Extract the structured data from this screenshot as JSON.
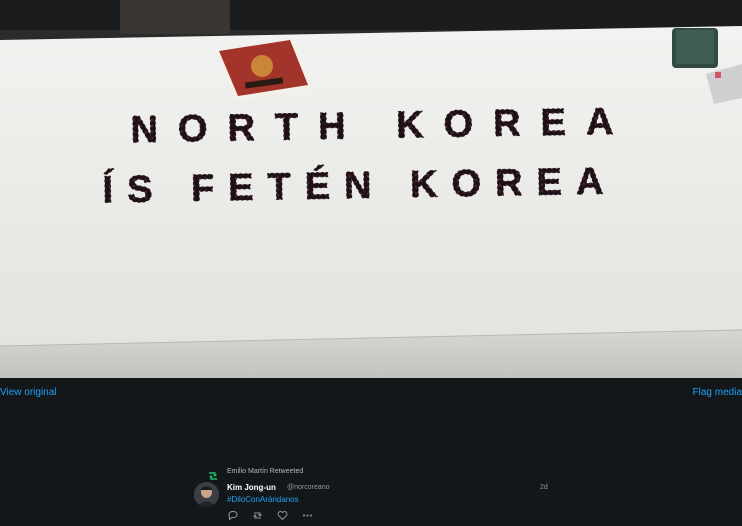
{
  "media": {
    "view_original_label": "View original",
    "flag_media_label": "Flag media",
    "photo": {
      "line1": "NORTH KOREA",
      "line2": "ÍS FETÉN KOREA",
      "colors": {
        "table": "#e9e9e6",
        "table_edge": "#c9c9c6",
        "berries": "#2a1820"
      }
    }
  },
  "tweet": {
    "retweet_text": "Emilio Martín Retweeted",
    "author_name": "Kim Jong-un",
    "author_handle": "@norcoreano",
    "time": "2d",
    "hashtag": "#DiloConArándanos",
    "icons": [
      "reply-icon",
      "retweet-icon",
      "like-icon",
      "more-icon"
    ]
  },
  "colors": {
    "background": "#14171a",
    "link": "#1da1f2",
    "retweet": "#17bf63"
  }
}
